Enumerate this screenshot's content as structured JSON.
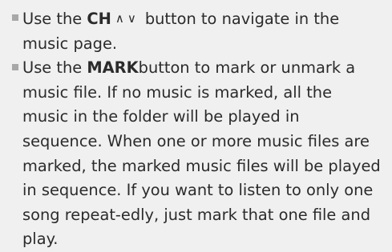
{
  "bullets": [
    {
      "before": "Use the ",
      "keyword": "CH",
      "arrows": "∧∨",
      "after": "button to navigate in the music page."
    },
    {
      "before": "Use the ",
      "keyword": "MARK",
      "after": "button to mark or unmark a music file. If no music is marked, all the music in the folder will be played in sequence. When one or more music files are marked, the marked music files will be played in sequence. If you want to listen to only one song repeat-edly, just mark that one file and play."
    }
  ]
}
